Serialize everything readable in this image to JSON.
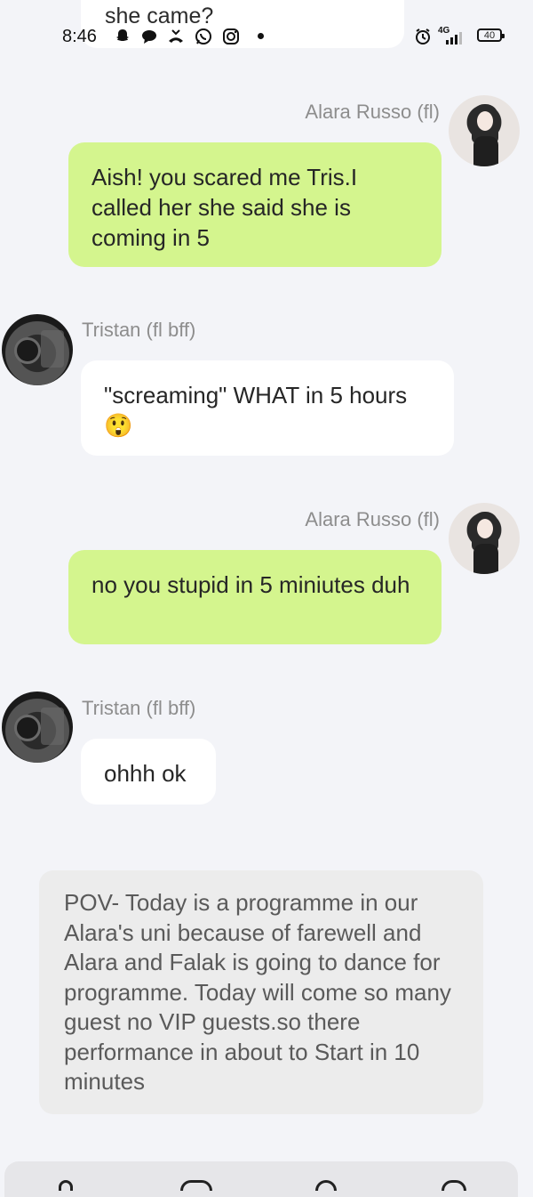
{
  "previous_message": {
    "text": "she came?"
  },
  "status_bar": {
    "time": "8:46",
    "icons": [
      "snapchat-icon",
      "chat-bubble-icon",
      "missed-call-icon",
      "whatsapp-icon",
      "instagram-icon"
    ],
    "network": "4G",
    "battery": "40"
  },
  "messages": [
    {
      "sender": "Alara Russo (fl)",
      "side": "right",
      "text": "Aish!  you scared me Tris.I called her she said she is coming in 5"
    },
    {
      "sender": "Tristan (fl bff)",
      "side": "left",
      "text": "\"screaming\" WHAT in 5 hours 😲"
    },
    {
      "sender": "Alara Russo (fl)",
      "side": "right",
      "text": "no you stupid in 5 miniutes duh"
    },
    {
      "sender": "Tristan (fl bff)",
      "side": "left",
      "text": "ohhh ok"
    }
  ],
  "narration": {
    "text": "POV- Today is a programme in our Alara's uni because of farewell and Alara and Falak is going to dance for programme. Today will come so many guest no VIP guests.so there performance in about to Start in 10 minutes"
  },
  "colors": {
    "background": "#f3f4f8",
    "green_bubble": "#d4f58e",
    "white_bubble": "#ffffff",
    "narration_bubble": "#ececec",
    "name_text": "#8d8d8d"
  }
}
